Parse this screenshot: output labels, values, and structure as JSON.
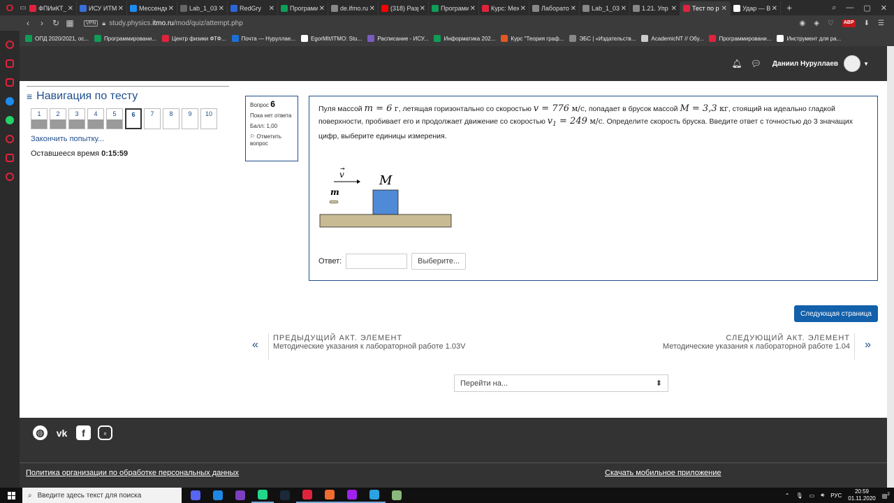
{
  "browser": {
    "tabs": [
      {
        "title": "ФПИиКТ_",
        "color": "#e0233d"
      },
      {
        "title": "ИСУ ИТМ",
        "color": "#3a6fd8"
      },
      {
        "title": "Мессендж",
        "color": "#1d8cf0"
      },
      {
        "title": "Lab_1_03V",
        "color": "#666666"
      },
      {
        "title": "RedGry",
        "color": "#2b66d9"
      },
      {
        "title": "Програми",
        "color": "#0f9d58"
      },
      {
        "title": "de.ifmo.ru",
        "color": "#888888"
      },
      {
        "title": "(318) Разр",
        "color": "#ff0000"
      },
      {
        "title": "Програми",
        "color": "#0f9d58"
      },
      {
        "title": "Курс: Мех",
        "color": "#e0233d"
      },
      {
        "title": "Лаборато",
        "color": "#888888"
      },
      {
        "title": "Lab_1_03V",
        "color": "#888888"
      },
      {
        "title": "1.21. Упр",
        "color": "#888888"
      },
      {
        "title": "Тест по р",
        "color": "#e0233d",
        "active": true
      },
      {
        "title": "Удар — В",
        "color": "#ffffff"
      }
    ],
    "vpn_label": "VPN",
    "url_host": "study.physics.",
    "url_bold": "itmo.ru",
    "url_path": "/mod/quiz/attempt.php",
    "adblock_label": "ABP",
    "bookmarks": [
      {
        "label": "ОПД 2020/2021, ос...",
        "color": "#0f9d58"
      },
      {
        "label": "Программировани...",
        "color": "#0f9d58"
      },
      {
        "label": "Центр физики ФТФ...",
        "color": "#e0233d"
      },
      {
        "label": "Почта — Нуруллае...",
        "color": "#1d6fd8"
      },
      {
        "label": "EgorMIt/ITMO: Stu...",
        "color": "#ffffff"
      },
      {
        "label": "Расписание - ИСУ...",
        "color": "#7a5cc0"
      },
      {
        "label": "Информатика 202...",
        "color": "#0f9d58"
      },
      {
        "label": "Курс \"Теория граф...",
        "color": "#e25822"
      },
      {
        "label": "ЭБС | «Издательств...",
        "color": "#888888"
      },
      {
        "label": "AcademicNT // Обу...",
        "color": "#cccccc"
      },
      {
        "label": "Программировани...",
        "color": "#e0233d"
      },
      {
        "label": "Инструмент для ра...",
        "color": "#ffffff"
      }
    ]
  },
  "header": {
    "user_name": "Даниил Нуруллаев"
  },
  "quiz_nav": {
    "title": "Навигация по тесту",
    "questions": [
      {
        "label": "1",
        "state": "done"
      },
      {
        "label": "2",
        "state": "done"
      },
      {
        "label": "3",
        "state": "done"
      },
      {
        "label": "4",
        "state": "done"
      },
      {
        "label": "5",
        "state": "done"
      },
      {
        "label": "6",
        "state": "current"
      },
      {
        "label": "7",
        "state": "empty"
      },
      {
        "label": "8",
        "state": "empty"
      },
      {
        "label": "9",
        "state": "empty"
      },
      {
        "label": "10",
        "state": "empty"
      }
    ],
    "finish_label": "Закончить попытку...",
    "time_label": "Оставшееся время",
    "time_value": "0:15:59"
  },
  "question_info": {
    "prefix": "Вопрос",
    "number": "6",
    "status": "Пока нет ответа",
    "score": "Балл: 1,00",
    "flag_label": "Отметить вопрос"
  },
  "question": {
    "t1": "Пуля массой ",
    "m": "m = 6",
    "u1": " г",
    "t2": ", летящая  горизонтально со скоростью ",
    "v": "v = 776",
    "u2": " м/c",
    "t3": ", попадает в брусок массой ",
    "M": "M = 3,3",
    "u3": " кг",
    "t4": ", стоящий на идеально гладкой поверхности,  пробивает его и продолжает движение со скоростью ",
    "v1": "v",
    "v1_sub": "1",
    "v1_val": " = 249",
    "u4": " м/c",
    "t5": ". Определите скорость бруска. Введите ответ с точностью до 3 значащих цифр, выберите единицы измерения.",
    "figure": {
      "v_label": "v",
      "m_label": "m",
      "M_label": "M",
      "block_color": "#4f8ad6",
      "ground_color": "#c8bb94"
    },
    "answer_label": "Ответ:",
    "unit_placeholder": "Выберите..."
  },
  "next_page_label": "Следующая страница",
  "activity_nav": {
    "prev_caption": "ПРЕДЫДУЩИЙ АКТ. ЭЛЕМЕНТ",
    "prev_link": "Методические указания к лабораторной работе 1.03V",
    "next_caption": "СЛЕДУЮЩИЙ АКТ. ЭЛЕМЕНТ",
    "next_link": "Методические указания к лабораторной работе 1.04"
  },
  "jump_label": "Перейти на...",
  "footer": {
    "privacy_link": "Политика организации по обработке персональных данных",
    "app_link": "Скачать мобильное приложение",
    "social": [
      "globe-icon",
      "vk-icon",
      "facebook-icon",
      "instagram-icon"
    ]
  },
  "taskbar": {
    "search_placeholder": "Введите здесь текст для поиска",
    "apps": [
      {
        "name": "discord",
        "color": "#5865f2"
      },
      {
        "name": "vscode",
        "color": "#1e88e5"
      },
      {
        "name": "visual-studio",
        "color": "#7b3fbf"
      },
      {
        "name": "pycharm",
        "color": "#21d789",
        "running": true
      },
      {
        "name": "steam",
        "color": "#1b2838"
      },
      {
        "name": "opera",
        "color": "#e0233d",
        "running": true
      },
      {
        "name": "intellij",
        "color": "#f26b2f",
        "running": true
      },
      {
        "name": "rider",
        "color": "#a020f0",
        "running": true
      },
      {
        "name": "telegram",
        "color": "#2aa3e0",
        "running": true
      },
      {
        "name": "tool",
        "color": "#8ab87a"
      }
    ],
    "language": "РУС",
    "time": "20:59",
    "date": "01.11.2020",
    "notifications": "2"
  }
}
